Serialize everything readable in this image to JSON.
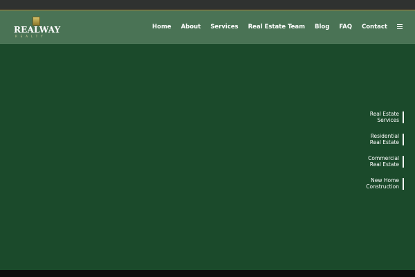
{
  "brand": {
    "name": "REALWAY",
    "tagline": "REALTY"
  },
  "nav": {
    "items": [
      "Home",
      "About",
      "Services",
      "Real Estate Team",
      "Blog",
      "FAQ",
      "Contact"
    ],
    "menu_icon": "hamburger-menu-icon"
  },
  "side_links": [
    {
      "line1": "Real Estate",
      "line2": "Services"
    },
    {
      "line1": "Residential",
      "line2": "Real Estate"
    },
    {
      "line1": "Commercial",
      "line2": "Real Estate"
    },
    {
      "line1": "New Home",
      "line2": "Construction"
    }
  ],
  "colors": {
    "background": "#1b4a2b",
    "header": "#4a7355",
    "topbar": "#2f3230",
    "accent": "#b38a34"
  }
}
